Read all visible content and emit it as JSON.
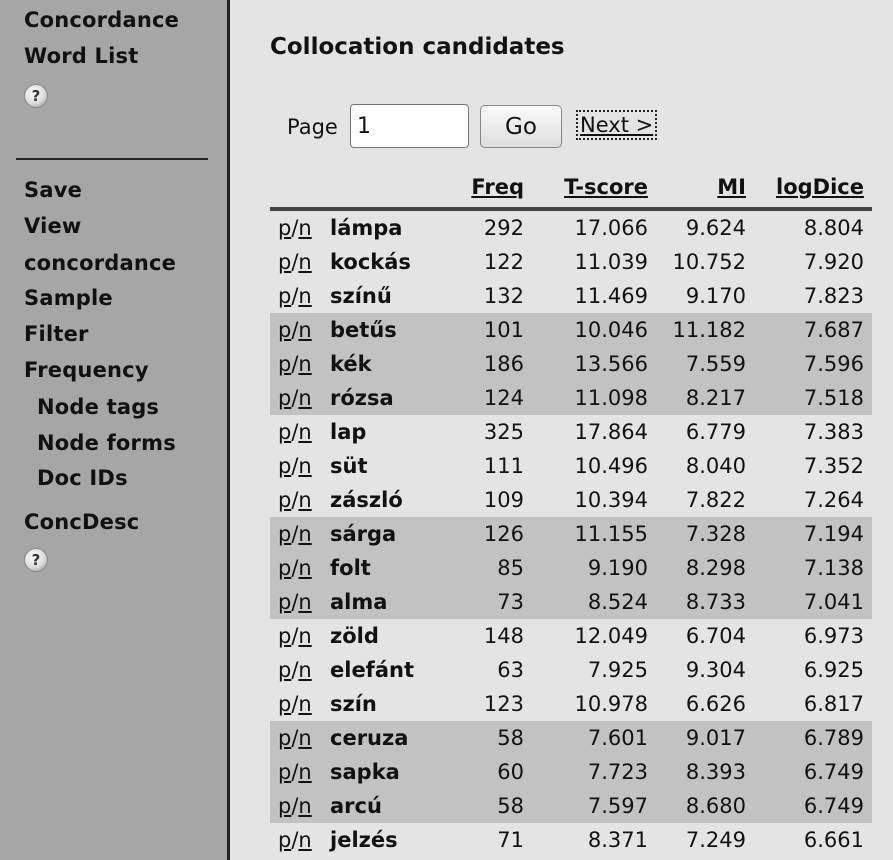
{
  "sidebar": {
    "top_links": [
      "Concordance",
      "Word List"
    ],
    "help_icon": "?",
    "links": [
      {
        "label": "Save",
        "sub": false
      },
      {
        "label": "View",
        "sub": false
      },
      {
        "label": "concordance",
        "sub": false
      },
      {
        "label": "Sample",
        "sub": false
      },
      {
        "label": "Filter",
        "sub": false
      },
      {
        "label": "Frequency",
        "sub": false
      },
      {
        "label": "Node tags",
        "sub": true
      },
      {
        "label": "Node forms",
        "sub": true
      },
      {
        "label": "Doc IDs",
        "sub": true
      },
      {
        "label": "ConcDesc",
        "sub": false
      }
    ]
  },
  "main": {
    "title": "Collocation candidates",
    "pager": {
      "label": "Page",
      "value": "1",
      "go_label": "Go",
      "next_label": "Next >"
    },
    "table": {
      "columns": [
        "Freq",
        "T-score",
        "MI",
        "logDice"
      ],
      "p_label": "p",
      "n_label": "n",
      "rows": [
        {
          "word": "lámpa",
          "freq": "292",
          "tscore": "17.066",
          "mi": "9.624",
          "logdice": "8.804"
        },
        {
          "word": "kockás",
          "freq": "122",
          "tscore": "11.039",
          "mi": "10.752",
          "logdice": "7.920"
        },
        {
          "word": "színű",
          "freq": "132",
          "tscore": "11.469",
          "mi": "9.170",
          "logdice": "7.823"
        },
        {
          "word": "betűs",
          "freq": "101",
          "tscore": "10.046",
          "mi": "11.182",
          "logdice": "7.687"
        },
        {
          "word": "kék",
          "freq": "186",
          "tscore": "13.566",
          "mi": "7.559",
          "logdice": "7.596"
        },
        {
          "word": "rózsa",
          "freq": "124",
          "tscore": "11.098",
          "mi": "8.217",
          "logdice": "7.518"
        },
        {
          "word": "lap",
          "freq": "325",
          "tscore": "17.864",
          "mi": "6.779",
          "logdice": "7.383"
        },
        {
          "word": "süt",
          "freq": "111",
          "tscore": "10.496",
          "mi": "8.040",
          "logdice": "7.352"
        },
        {
          "word": "zászló",
          "freq": "109",
          "tscore": "10.394",
          "mi": "7.822",
          "logdice": "7.264"
        },
        {
          "word": "sárga",
          "freq": "126",
          "tscore": "11.155",
          "mi": "7.328",
          "logdice": "7.194"
        },
        {
          "word": "folt",
          "freq": "85",
          "tscore": "9.190",
          "mi": "8.298",
          "logdice": "7.138"
        },
        {
          "word": "alma",
          "freq": "73",
          "tscore": "8.524",
          "mi": "8.733",
          "logdice": "7.041"
        },
        {
          "word": "zöld",
          "freq": "148",
          "tscore": "12.049",
          "mi": "6.704",
          "logdice": "6.973"
        },
        {
          "word": "elefánt",
          "freq": "63",
          "tscore": "7.925",
          "mi": "9.304",
          "logdice": "6.925"
        },
        {
          "word": "szín",
          "freq": "123",
          "tscore": "10.978",
          "mi": "6.626",
          "logdice": "6.817"
        },
        {
          "word": "ceruza",
          "freq": "58",
          "tscore": "7.601",
          "mi": "9.017",
          "logdice": "6.789"
        },
        {
          "word": "sapka",
          "freq": "60",
          "tscore": "7.723",
          "mi": "8.393",
          "logdice": "6.749"
        },
        {
          "word": "arcú",
          "freq": "58",
          "tscore": "7.597",
          "mi": "8.680",
          "logdice": "6.749"
        },
        {
          "word": "jelzés",
          "freq": "71",
          "tscore": "8.371",
          "mi": "7.249",
          "logdice": "6.661"
        }
      ]
    }
  }
}
